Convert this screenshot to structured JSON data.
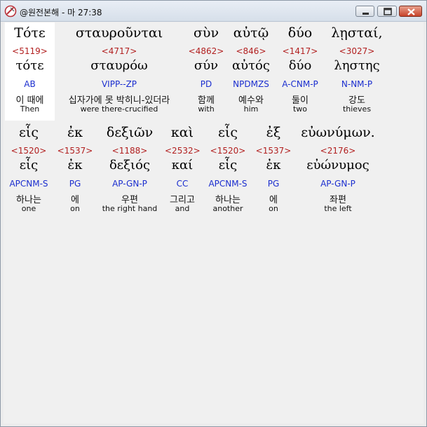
{
  "window": {
    "title": "@원전본해 - 마 27:38",
    "icon": "app-logo-icon",
    "controls": [
      "minimize-icon",
      "maximize-icon",
      "close-icon"
    ]
  },
  "rows": [
    {
      "words": [
        {
          "greek": "Τότε",
          "strong": "<5119>",
          "lemma": "τότε",
          "morph": "AB",
          "korean": "이 때에",
          "english": "Then"
        },
        {
          "greek": "σταυροῦνται",
          "strong": "<4717>",
          "lemma": "σταυρόω",
          "morph": "VIPP--ZP",
          "korean": "십자가에 못 박히니-있더라",
          "english": "were there-crucified"
        },
        {
          "greek": "σὺν",
          "strong": "<4862>",
          "lemma": "σύν",
          "morph": "PD",
          "korean": "함께",
          "english": "with"
        },
        {
          "greek": "αὐτῷ",
          "strong": "<846>",
          "lemma": "αὐτός",
          "morph": "NPDMZS",
          "korean": "예수와",
          "english": "him"
        },
        {
          "greek": "δύο",
          "strong": "<1417>",
          "lemma": "δύο",
          "morph": "A-CNM-P",
          "korean": "둘이",
          "english": "two"
        },
        {
          "greek": "λῃσταί,",
          "strong": "<3027>",
          "lemma": "ληστης",
          "morph": "N-NM-P",
          "korean": "강도",
          "english": "thieves"
        }
      ]
    },
    {
      "words": [
        {
          "greek": "εἷς",
          "strong": "<1520>",
          "lemma": "εἷς",
          "morph": "APCNM-S",
          "korean": "하나는",
          "english": "one"
        },
        {
          "greek": "ἐκ",
          "strong": "<1537>",
          "lemma": "ἐκ",
          "morph": "PG",
          "korean": "에",
          "english": "on"
        },
        {
          "greek": "δεξιῶν",
          "strong": "<1188>",
          "lemma": "δεξιός",
          "morph": "AP-GN-P",
          "korean": "우편",
          "english": "the right hand"
        },
        {
          "greek": "καὶ",
          "strong": "<2532>",
          "lemma": "καί",
          "morph": "CC",
          "korean": "그리고",
          "english": "and"
        },
        {
          "greek": "εἷς",
          "strong": "<1520>",
          "lemma": "εἷς",
          "morph": "APCNM-S",
          "korean": "하나는",
          "english": "another"
        },
        {
          "greek": "ἐξ",
          "strong": "<1537>",
          "lemma": "ἐκ",
          "morph": "PG",
          "korean": "에",
          "english": "on"
        },
        {
          "greek": "εὐωνύμων.",
          "strong": "<2176>",
          "lemma": "εὐώνυμος",
          "morph": "AP-GN-P",
          "korean": "좌편",
          "english": "the left"
        }
      ]
    }
  ],
  "colors": {
    "strong": "#b22020",
    "morph": "#1b2ecf",
    "selected_bg": "#ffffff",
    "client_bg": "#f0f0f0"
  }
}
